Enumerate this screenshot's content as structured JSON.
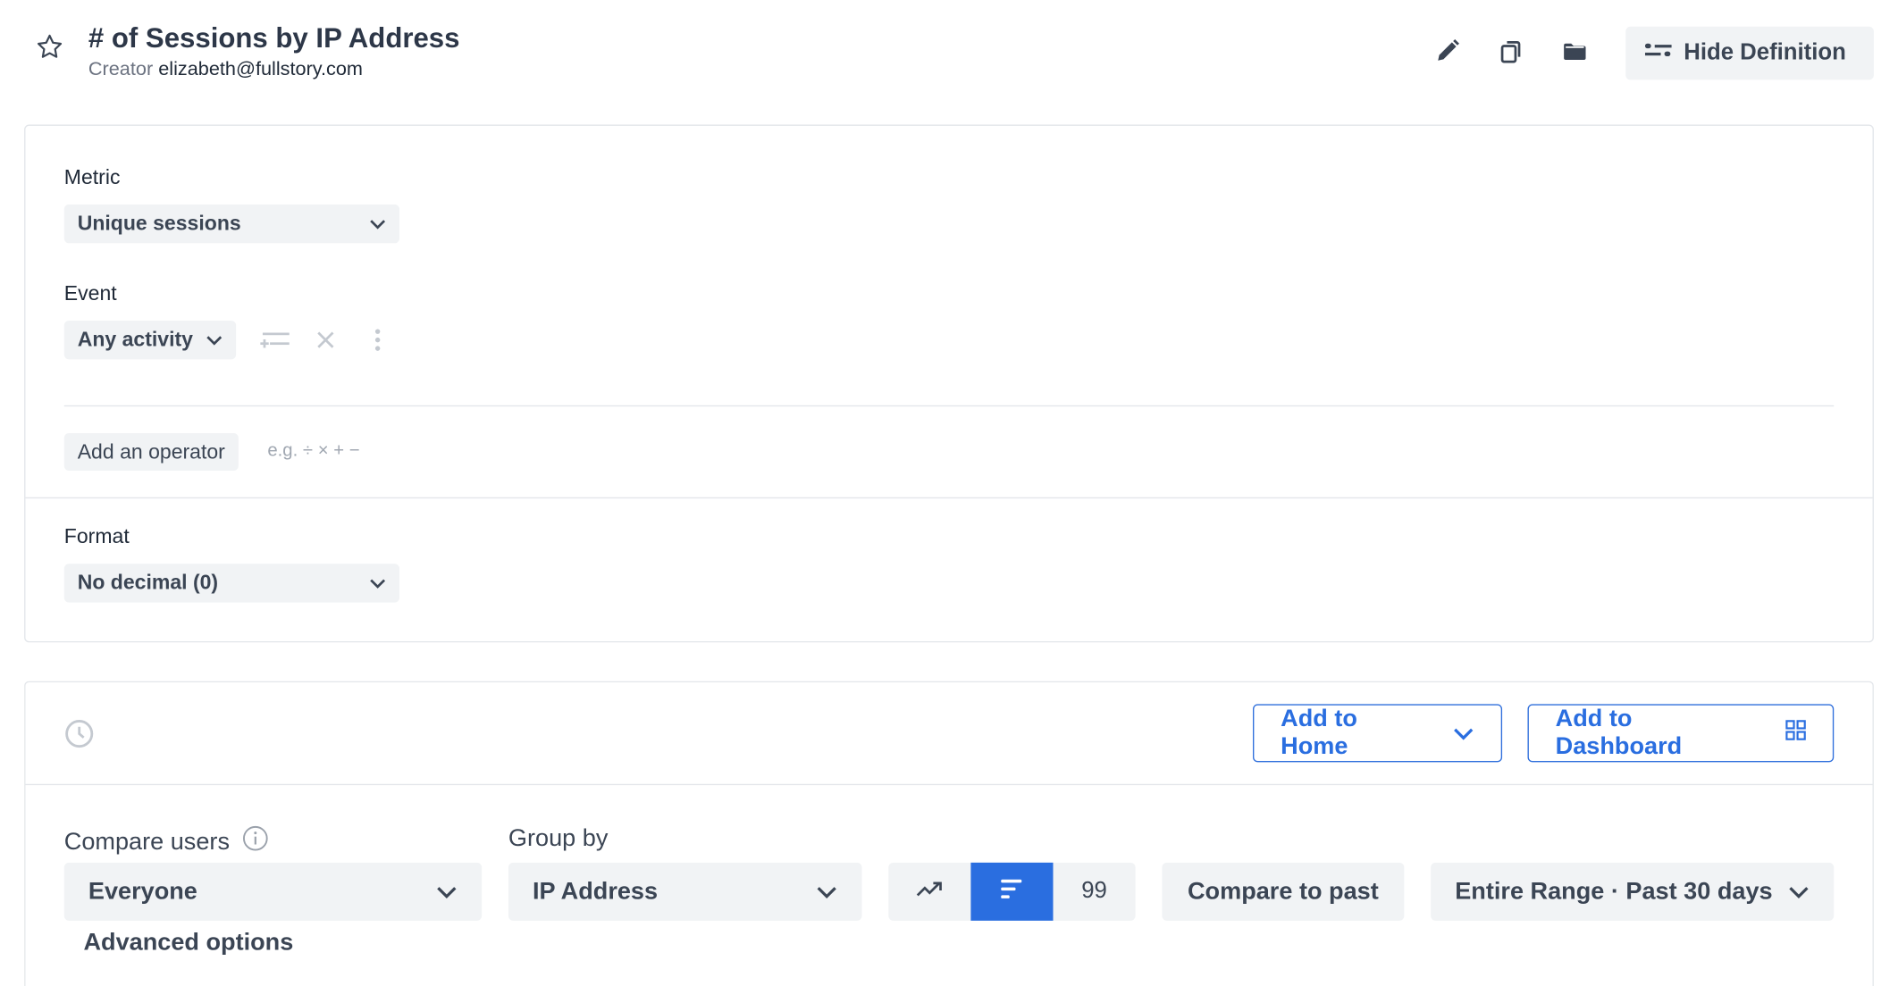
{
  "header": {
    "title": "# of Sessions by IP Address",
    "creator_label": "Creator",
    "creator_email": "elizabeth@fullstory.com",
    "hide_definition_label": "Hide Definition"
  },
  "definition": {
    "metric_label": "Metric",
    "metric_value": "Unique sessions",
    "event_label": "Event",
    "event_value": "Any activity",
    "add_operator_label": "Add an operator",
    "operator_hint": "e.g. ÷ × + −",
    "format_label": "Format",
    "format_value": "No decimal (0)"
  },
  "report": {
    "add_to_home_label": "Add to Home",
    "add_to_dashboard_label": "Add to Dashboard",
    "compare_users_label": "Compare users",
    "compare_users_value": "Everyone",
    "group_by_label": "Group by",
    "group_by_value": "IP Address",
    "limit_value": "99",
    "compare_to_past_label": "Compare to past",
    "date_range_value": "Entire Range · Past 30 days",
    "advanced_options_label": "Advanced options"
  },
  "colors": {
    "accent": "#2a6ee0",
    "control_bg": "#f1f3f5",
    "border": "#e3e6ea",
    "text": "#3b4554"
  },
  "icons": [
    "star-icon",
    "pencil-icon",
    "copy-icon",
    "folder-icon",
    "sliders-icon",
    "chevron-down-icon",
    "filter-add-icon",
    "close-icon",
    "more-vertical-icon",
    "clock-icon",
    "grid-icon",
    "info-icon",
    "trend-icon",
    "bar-sort-icon"
  ]
}
